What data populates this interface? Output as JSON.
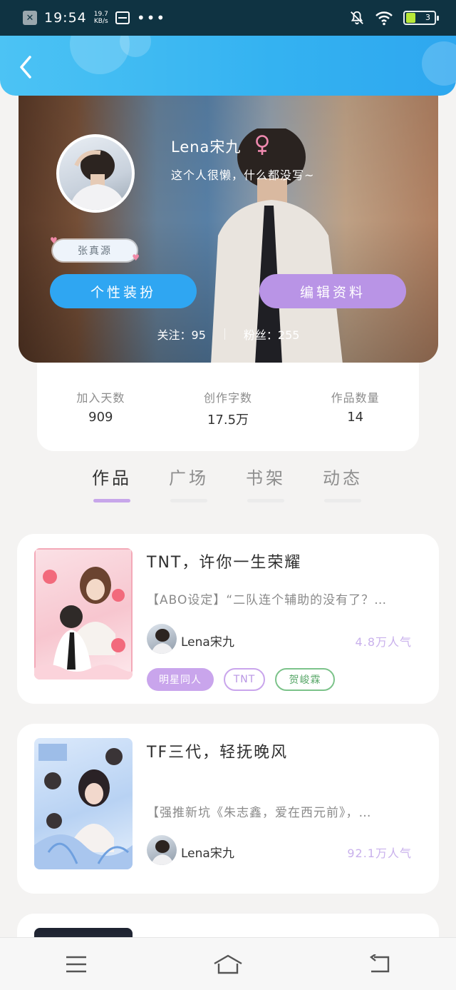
{
  "status_bar": {
    "time": "19:54",
    "net_speed_value": "19.7",
    "net_speed_unit": "KB/s",
    "battery": "3",
    "battery_level": 0.3
  },
  "header": {
    "back_icon": "chevron-left-icon",
    "color": "#34b2f1"
  },
  "profile": {
    "nickname": "Lena宋九",
    "gender_icon": "female-icon",
    "signature": "这个人很懒，什么都没写~",
    "idol_tag": "张真源",
    "dress_button": "个性装扮",
    "edit_button": "编辑资料",
    "following": "关注：95",
    "followers": "粉丝：255"
  },
  "stats": [
    {
      "label": "加入天数",
      "value": "909"
    },
    {
      "label": "创作字数",
      "value": "17.5万"
    },
    {
      "label": "作品数量",
      "value": "14"
    }
  ],
  "tabs": [
    {
      "label": "作品",
      "active": true
    },
    {
      "label": "广场",
      "active": false
    },
    {
      "label": "书架",
      "active": false
    },
    {
      "label": "动态",
      "active": false
    }
  ],
  "works": [
    {
      "title": "TNT，许你一生荣耀",
      "desc": "【ABO设定】“二队连个辅助的没有了？…",
      "author": "Lena宋九",
      "popularity": "4.8万人气",
      "tags": [
        "明星同人",
        "TNT",
        "贺峻霖"
      ]
    },
    {
      "title": "TF三代，轻抚晚风",
      "desc": "【强推新坑《朱志鑫，爱在西元前》，…",
      "author": "Lena宋九",
      "popularity": "92.1万人气",
      "tags": []
    }
  ],
  "colors": {
    "accent_blue": "#2fa6f2",
    "accent_purple": "#b994e6",
    "tab_active": "#c7a6ea",
    "popularity": "#c9b1ec"
  },
  "nav": {
    "menu_icon": "menu-icon",
    "home_icon": "home-icon",
    "back_icon": "return-icon"
  }
}
